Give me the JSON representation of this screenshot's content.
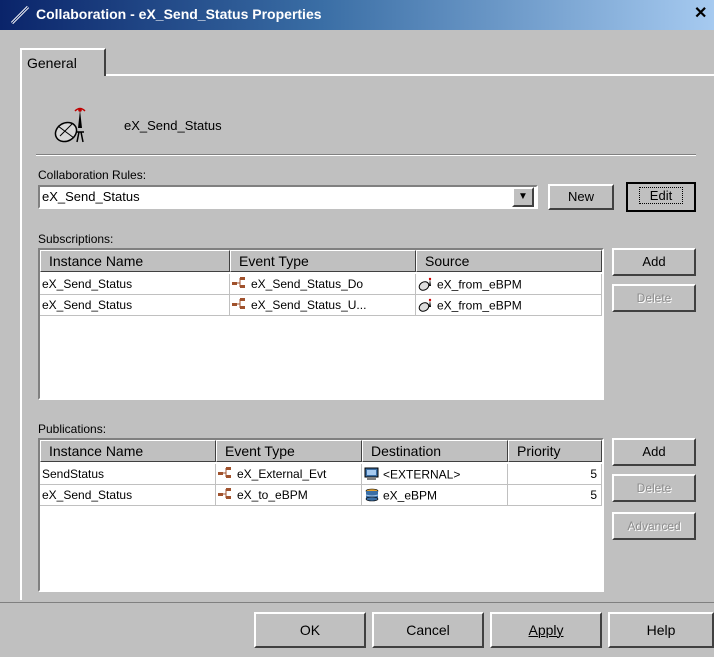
{
  "window": {
    "title": "Collaboration - eX_Send_Status Properties",
    "close_glyph": "✕"
  },
  "tabs": [
    {
      "label": "General"
    }
  ],
  "header": {
    "name": "eX_Send_Status",
    "icon": "satellite-dish-icon"
  },
  "rules": {
    "label": "Collaboration Rules:",
    "selected": "eX_Send_Status",
    "dropdown_glyph": "▼",
    "new_label": "New",
    "edit_label": "Edit"
  },
  "subscriptions": {
    "label": "Subscriptions:",
    "columns": [
      "Instance Name",
      "Event Type",
      "Source"
    ],
    "rows": [
      {
        "instance": "eX_Send_Status",
        "event": "eX_Send_Status_Do",
        "source": "eX_from_eBPM"
      },
      {
        "instance": "eX_Send_Status",
        "event": "eX_Send_Status_U...",
        "source": "eX_from_eBPM"
      }
    ],
    "add_label": "Add",
    "delete_label": "Delete"
  },
  "publications": {
    "label": "Publications:",
    "columns": [
      "Instance Name",
      "Event Type",
      "Destination",
      "Priority"
    ],
    "rows": [
      {
        "instance": "SendStatus",
        "event": "eX_External_Evt",
        "destination": "<EXTERNAL>",
        "priority": "5",
        "dest_icon": "monitor-icon"
      },
      {
        "instance": "eX_Send_Status",
        "event": "eX_to_eBPM",
        "destination": "eX_eBPM",
        "priority": "5",
        "dest_icon": "database-icon"
      }
    ],
    "add_label": "Add",
    "delete_label": "Delete",
    "advanced_label": "Advanced"
  },
  "footer": {
    "ok_label": "OK",
    "cancel_label": "Cancel",
    "apply_label": "Apply",
    "help_label": "Help"
  },
  "colors": {
    "titlebar_start": "#0a246a",
    "titlebar_end": "#a6caf0",
    "dialog_gray": "#c0c0c0",
    "disabled_text": "#8c8c8c"
  }
}
